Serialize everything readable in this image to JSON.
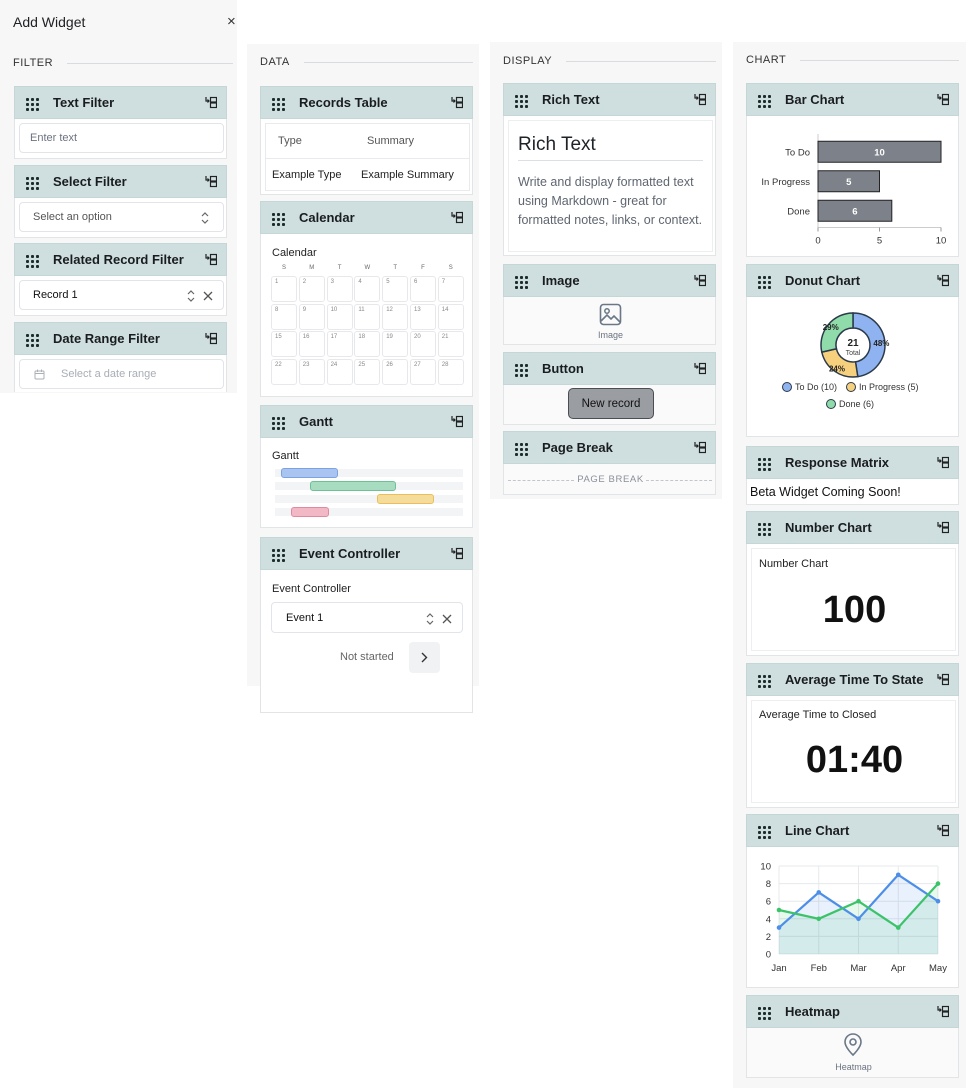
{
  "panel": {
    "title": "Add Widget",
    "close": "×"
  },
  "sections": {
    "filter": "FILTER",
    "data": "DATA",
    "display": "DISPLAY",
    "chart": "CHART"
  },
  "filter": {
    "text": {
      "title": "Text Filter",
      "placeholder": "Enter text"
    },
    "select": {
      "title": "Select Filter",
      "placeholder": "Select an option"
    },
    "related": {
      "title": "Related Record Filter",
      "value": "Record 1"
    },
    "date": {
      "title": "Date Range Filter",
      "placeholder": "Select a date range"
    }
  },
  "data": {
    "records": {
      "title": "Records Table",
      "headers": [
        "Type",
        "Summary"
      ],
      "row": [
        "Example Type",
        "Example Summary"
      ]
    },
    "calendar": {
      "title": "Calendar",
      "label": "Calendar",
      "days": [
        "S",
        "M",
        "T",
        "W",
        "T",
        "F",
        "S"
      ],
      "dates": [
        "1",
        "2",
        "3",
        "4",
        "5",
        "6",
        "7",
        "8",
        "9",
        "10",
        "11",
        "12",
        "13",
        "14",
        "15",
        "16",
        "17",
        "18",
        "19",
        "20",
        "21",
        "22",
        "23",
        "24",
        "25",
        "26",
        "27",
        "28"
      ]
    },
    "gantt": {
      "title": "Gantt",
      "label": "Gantt",
      "colors": [
        "#a9c4f0",
        "#a8dcc0",
        "#f6dc9a",
        "#f2b8c6"
      ]
    },
    "event": {
      "title": "Event Controller",
      "label": "Event Controller",
      "value": "Event 1",
      "status": "Not started"
    }
  },
  "display": {
    "rich": {
      "title": "Rich Text",
      "heading": "Rich Text",
      "body": "Write and display formatted text using Markdown - great for formatted notes, links, or context."
    },
    "image": {
      "title": "Image",
      "caption": "Image"
    },
    "button": {
      "title": "Button",
      "label": "New record"
    },
    "pagebreak": {
      "title": "Page Break",
      "label": "PAGE BREAK"
    }
  },
  "charts": {
    "bar": {
      "title": "Bar Chart"
    },
    "donut": {
      "title": "Donut Chart",
      "total": "21",
      "total_label": "Total",
      "legend": [
        "To Do (10)",
        "In Progress (5)",
        "Done (6)"
      ],
      "pct": [
        "48%",
        "24%",
        "29%"
      ]
    },
    "matrix": {
      "title": "Response Matrix",
      "text": "Beta Widget Coming Soon!"
    },
    "number": {
      "title": "Number Chart",
      "label": "Number Chart",
      "value": "100"
    },
    "avg": {
      "title": "Average Time To State",
      "label": "Average Time to Closed",
      "value": "01:40"
    },
    "line": {
      "title": "Line Chart"
    },
    "heatmap": {
      "title": "Heatmap",
      "caption": "Heatmap"
    }
  },
  "chart_data": [
    {
      "type": "bar",
      "orientation": "horizontal",
      "categories": [
        "To Do",
        "In Progress",
        "Done"
      ],
      "values": [
        10,
        5,
        6
      ],
      "xlim": [
        0,
        10
      ],
      "xticks": [
        "0",
        "5",
        "10"
      ],
      "color": "#7d828a"
    },
    {
      "type": "pie",
      "variant": "donut",
      "labels": [
        "To Do",
        "In Progress",
        "Done"
      ],
      "values": [
        10,
        5,
        6
      ],
      "colors": [
        "#8fb3f0",
        "#f6d07d",
        "#8fdcaa"
      ]
    },
    {
      "type": "line",
      "categories": [
        "Jan",
        "Feb",
        "Mar",
        "Apr",
        "May"
      ],
      "ylim": [
        0,
        10
      ],
      "yticks": [
        "0",
        "2",
        "4",
        "6",
        "8",
        "10"
      ],
      "series": [
        {
          "values": [
            3,
            7,
            4,
            9,
            6
          ],
          "color": "#4d8ee8"
        },
        {
          "values": [
            5,
            4,
            6,
            3,
            8
          ],
          "color": "#3cc36a"
        }
      ]
    }
  ]
}
